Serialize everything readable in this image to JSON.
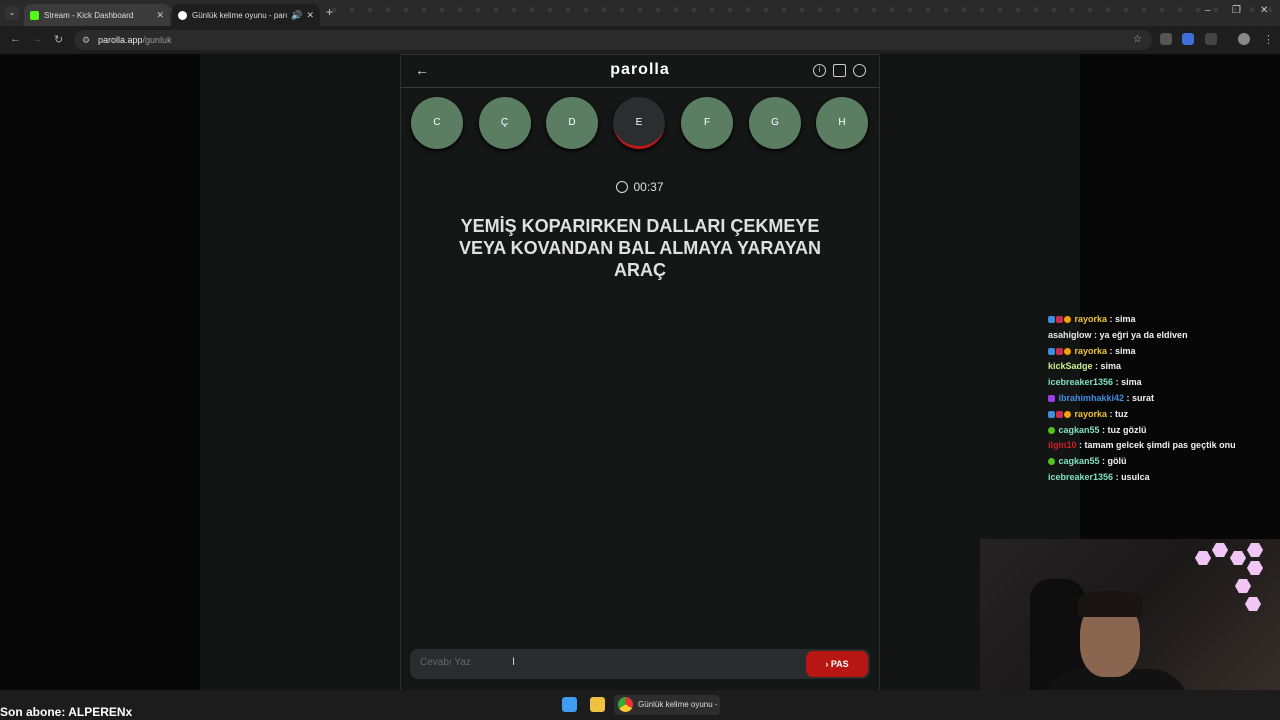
{
  "browser": {
    "tabs": [
      {
        "title": "Stream - Kick Dashboard"
      },
      {
        "title": "Günlük kelime oyunu - parolla"
      }
    ],
    "url_host": "parolla.app",
    "url_path": "/gunluk"
  },
  "game": {
    "logo": "parolla",
    "letters": [
      "C",
      "Ç",
      "D",
      "E",
      "F",
      "G",
      "H"
    ],
    "active_letter": "E",
    "timer": "00:37",
    "question": "YEMİŞ KOPARIRKEN DALLARI ÇEKMEYE VEYA KOVANDAN BAL ALMAYA YARAYAN ARAÇ",
    "answer_placeholder": "Cevabı Yaz",
    "pass_label": "PAS",
    "colors": {
      "letter": "#5b7d61",
      "pass": "#b81515",
      "active_ring": "#c21818"
    }
  },
  "chat": [
    {
      "user": "rayorka",
      "text": "sima",
      "color": "#f0c238"
    },
    {
      "user": "asahiglow",
      "text": "ya eğri ya da eldiven",
      "color": "#e8e8e8"
    },
    {
      "user": "rayorka",
      "text": "sima",
      "color": "#f0c238"
    },
    {
      "user": "kickSadge",
      "text": "sima",
      "color": "#c8f08c"
    },
    {
      "user": "icebreaker1356",
      "text": "sima",
      "color": "#7fe0c4"
    },
    {
      "user": "ibrahimhakki42",
      "text": "surat",
      "color": "#3e8edf"
    },
    {
      "user": "rayorka",
      "text": "tuz",
      "color": "#f0c238"
    },
    {
      "user": "cagkan55",
      "text": "tuz gözlü",
      "color": "#7fe0c4"
    },
    {
      "user": "ilgin10",
      "text": "tamam gelcek şimdi pas geçtik onu",
      "color": "#d11a2a"
    },
    {
      "user": "cagkan55",
      "text": "gölü",
      "color": "#7fe0c4"
    },
    {
      "user": "icebreaker1356",
      "text": "usulca",
      "color": "#7fe0c4"
    }
  ],
  "overlay": {
    "last_sub": "Son abone: ALPERENx"
  },
  "taskbar": {
    "active_window": "Günlük kelime oyunu - parolla"
  }
}
